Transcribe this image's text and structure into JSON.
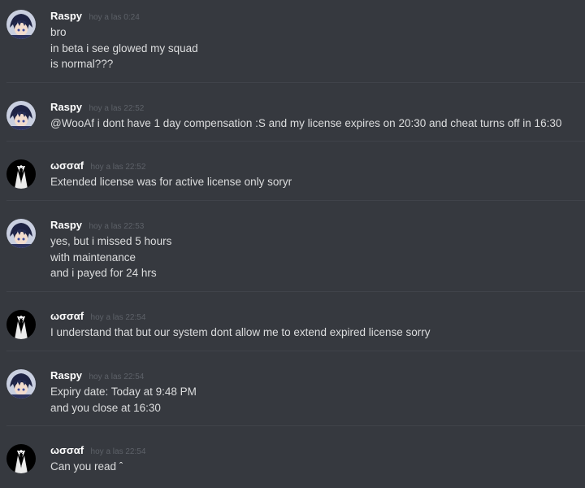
{
  "messages": [
    {
      "author": "Raspy",
      "avatar": "raspy-anime-avatar-icon",
      "timestamp": "hoy a las 0:24",
      "lines": [
        "bro",
        "in beta i see glowed my squad",
        "is normal???"
      ]
    },
    {
      "author": "Raspy",
      "avatar": "raspy-anime-avatar-icon",
      "timestamp": "hoy a las 22:52",
      "lines": [
        "@WooAf i dont have 1 day compensation :S and my license expires on 20:30 and cheat turns off in 16:30"
      ]
    },
    {
      "author": "ωσσαf",
      "avatar": "tuxedo-avatar-icon",
      "timestamp": "hoy a las 22:52",
      "lines": [
        "Extended license was for active license only soryr"
      ]
    },
    {
      "author": "Raspy",
      "avatar": "raspy-anime-avatar-icon",
      "timestamp": "hoy a las 22:53",
      "lines": [
        "yes, but i missed 5 hours",
        "with maintenance",
        "and i payed for 24 hrs"
      ]
    },
    {
      "author": "ωσσαf",
      "avatar": "tuxedo-avatar-icon",
      "timestamp": "hoy a las 22:54",
      "lines": [
        "I understand that but our system dont allow me to extend expired license sorry"
      ]
    },
    {
      "author": "Raspy",
      "avatar": "raspy-anime-avatar-icon",
      "timestamp": "hoy a las 22:54",
      "lines": [
        "Expiry date: Today at 9:48 PM",
        "and you close at 16:30"
      ]
    },
    {
      "author": "ωσσαf",
      "avatar": "tuxedo-avatar-icon",
      "timestamp": "hoy a las 22:54",
      "lines": [
        "Can you read ˆ"
      ]
    }
  ],
  "colors": {
    "background": "#36393f",
    "username": "#ffffff",
    "timestamp": "#5d6168",
    "message_text": "#dcddde",
    "divider": "#40434a"
  }
}
